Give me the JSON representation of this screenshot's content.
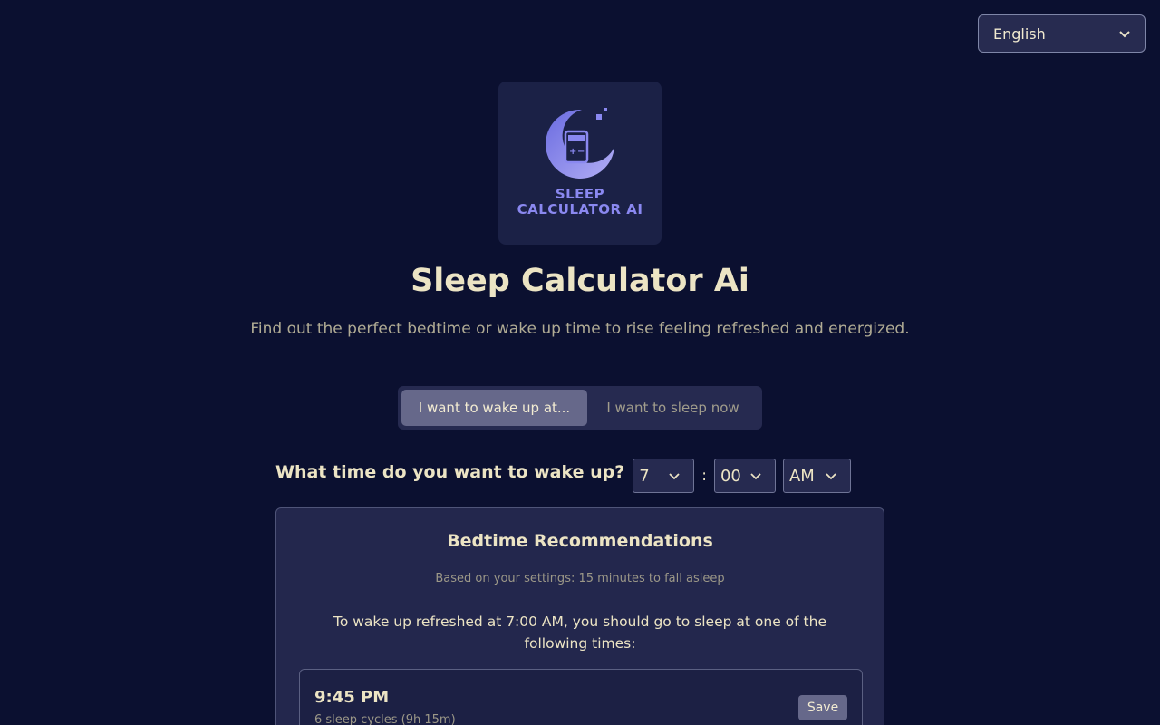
{
  "language": {
    "selected": "English"
  },
  "logo": {
    "line1": "SLEEP",
    "line2": "CALCULATOR AI"
  },
  "header": {
    "title": "Sleep Calculator Ai",
    "subtitle": "Find out the perfect bedtime or wake up time to rise feeling refreshed and energized."
  },
  "modes": {
    "wake": "I want to wake up at...",
    "sleep_now": "I want to sleep now"
  },
  "wake_time": {
    "label": "What time do you want to wake up?",
    "hour": "7",
    "separator": ":",
    "minute": "00",
    "period": "AM"
  },
  "recommendations": {
    "title": "Bedtime Recommendations",
    "note": "Based on your settings: 15 minutes to fall asleep",
    "intro": "To wake up refreshed at 7:00 AM, you should go to sleep at one of the following times:",
    "items": [
      {
        "time": "9:45 PM",
        "cycles": "6 sleep cycles (9h 15m)",
        "save_label": "Save"
      }
    ]
  },
  "colors": {
    "background": "#0b1030",
    "card": "#23274d",
    "text": "#ece4c4",
    "accent": "#8a88f0"
  },
  "icons": [
    "chevron-down-icon",
    "moon-calculator-logo"
  ]
}
